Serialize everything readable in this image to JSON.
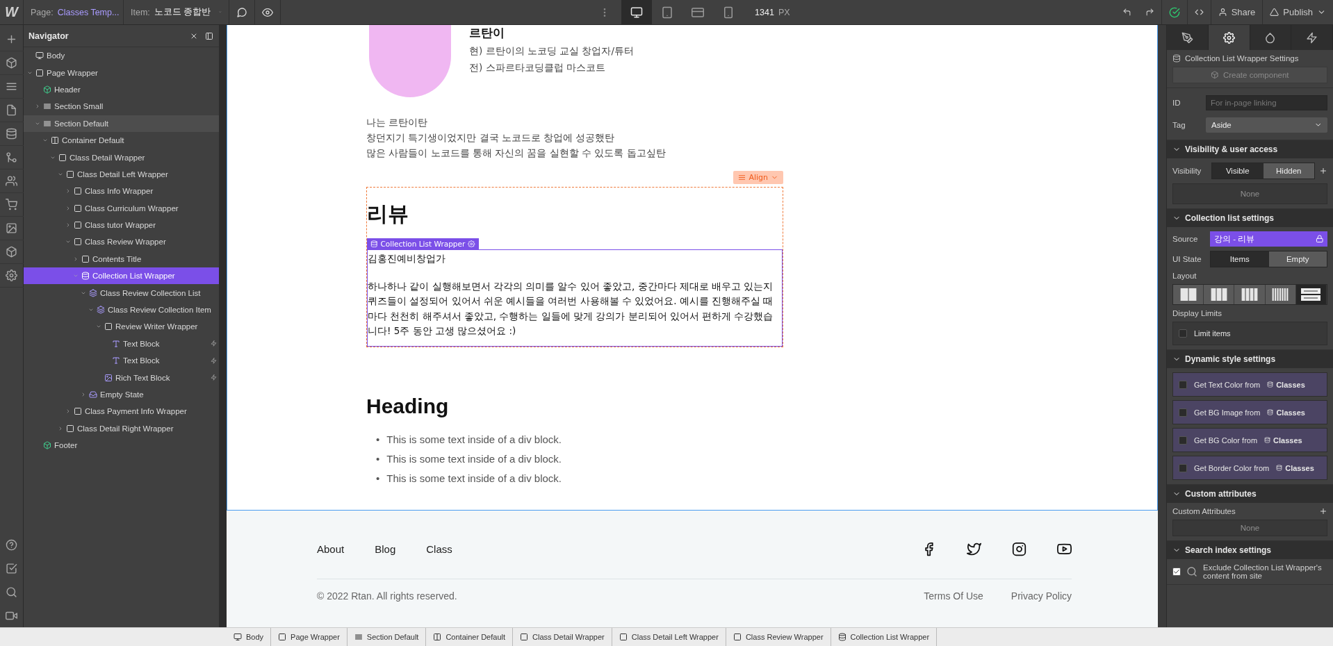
{
  "toolbar": {
    "logo": "W",
    "page_label": "Page:",
    "page_name": "Classes Temp...",
    "item_label": "Item:",
    "item_name": "노코드 종합반",
    "devices": [
      {
        "kind": "desktop",
        "selected": true
      },
      {
        "kind": "tablet",
        "selected": false
      },
      {
        "kind": "landscape",
        "selected": false
      },
      {
        "kind": "portrait",
        "selected": false
      }
    ],
    "width_value": "1341",
    "width_unit": "PX",
    "share": "Share",
    "publish": "Publish"
  },
  "navigator": {
    "title": "Navigator",
    "tree": [
      {
        "label": "Body",
        "kind": "body",
        "selected": false
      },
      {
        "label": "Page Wrapper",
        "kind": "box",
        "expanded": true,
        "selected": false,
        "children": [
          {
            "label": "Header",
            "kind": "symbol",
            "selected": false
          },
          {
            "label": "Section Small",
            "kind": "section",
            "expanded": false,
            "selected": false
          },
          {
            "label": "Section Default",
            "kind": "section",
            "expanded": true,
            "selected": false,
            "highlighted": true,
            "children": [
              {
                "label": "Container Default",
                "kind": "container",
                "expanded": true,
                "selected": false,
                "children": [
                  {
                    "label": "Class Detail Wrapper",
                    "kind": "box",
                    "expanded": true,
                    "selected": false,
                    "children": [
                      {
                        "label": "Class Detail Left Wrapper",
                        "kind": "box",
                        "expanded": true,
                        "selected": false,
                        "children": [
                          {
                            "label": "Class Info Wrapper",
                            "kind": "box",
                            "expanded": false,
                            "selected": false
                          },
                          {
                            "label": "Class Curriculum Wrapper",
                            "kind": "box",
                            "expanded": false,
                            "selected": false
                          },
                          {
                            "label": "Class tutor Wrapper",
                            "kind": "box",
                            "expanded": false,
                            "selected": false
                          },
                          {
                            "label": "Class Review Wrapper",
                            "kind": "box",
                            "expanded": true,
                            "selected": false,
                            "children": [
                              {
                                "label": "Contents Title",
                                "kind": "box",
                                "expanded": false,
                                "selected": false
                              },
                              {
                                "label": "Collection List Wrapper",
                                "kind": "collection",
                                "expanded": true,
                                "selected": true,
                                "children": [
                                  {
                                    "label": "Class Review Collection List",
                                    "kind": "collection-list",
                                    "expanded": true,
                                    "selected": false,
                                    "children": [
                                      {
                                        "label": "Class Review Collection Item",
                                        "kind": "collection-list",
                                        "expanded": true,
                                        "selected": false,
                                        "children": [
                                          {
                                            "label": "Review Writer Wrapper",
                                            "kind": "box",
                                            "expanded": true,
                                            "selected": false,
                                            "children": [
                                              {
                                                "label": "Text Block",
                                                "kind": "text",
                                                "bound": true,
                                                "selected": false
                                              },
                                              {
                                                "label": "Text Block",
                                                "kind": "text",
                                                "bound": true,
                                                "selected": false
                                              }
                                            ]
                                          },
                                          {
                                            "label": "Rich Text Block",
                                            "kind": "richtext",
                                            "bound": true,
                                            "selected": false
                                          }
                                        ]
                                      }
                                    ]
                                  },
                                  {
                                    "label": "Empty State",
                                    "kind": "empty",
                                    "expanded": false,
                                    "selected": false
                                  }
                                ]
                              }
                            ]
                          },
                          {
                            "label": "Class Payment Info Wrapper",
                            "kind": "box",
                            "expanded": false,
                            "selected": false
                          }
                        ]
                      },
                      {
                        "label": "Class Detail Right Wrapper",
                        "kind": "box",
                        "expanded": false,
                        "selected": false
                      }
                    ]
                  }
                ]
              }
            ]
          },
          {
            "label": "Footer",
            "kind": "symbol",
            "selected": false
          }
        ]
      }
    ]
  },
  "canvas": {
    "profile": {
      "name": "르탄이",
      "lines": [
        "현) 르탄이의 노코딩 교실 창업자/튜터",
        "전) 스파르타코딩클럽 마스코트"
      ]
    },
    "intro": [
      "나는 르탄이탄",
      "창던지기 특기생이었지만 결국 노코드로 창업에 성공했탄",
      "많은 사람들이 노코드를 통해 자신의 꿈을 실현할 수 있도록 돕고싶탄"
    ],
    "align_button": "Align",
    "review_heading": "리뷰",
    "selection_label": "Collection List Wrapper",
    "reviewer": "김홍진예비창업가",
    "review_text": "하나하나 같이 실행해보면서 각각의 의미를 알수 있어 좋았고, 중간마다 제대로 배우고 있는지 퀴즈들이 설정되어 있어서 쉬운 예시들을 여러번 사용해볼 수 있었어요. 예시를 진행해주실 때마다 천천히 해주셔서 좋았고, 수행하는 일들에 맞게 강의가 분리되어 있어서 편하게 수강했습니다! 5주 동안 고생 많으셨어요 :)",
    "heading": "Heading",
    "bullet_marker": "•",
    "bullets": [
      "This is some text inside of a div block.",
      "This is some text inside of a div block.",
      "This is some text inside of a div block."
    ]
  },
  "footer": {
    "links": [
      "About",
      "Blog",
      "Class"
    ],
    "social": [
      {
        "kind": "facebook"
      },
      {
        "kind": "twitter"
      },
      {
        "kind": "instagram"
      },
      {
        "kind": "youtube"
      }
    ],
    "copyright": "© 2022 Rtan. All rights reserved.",
    "legal_links": [
      "Terms Of Use",
      "Privacy Policy"
    ]
  },
  "breadcrumb": [
    {
      "label": "Body",
      "kind": "body"
    },
    {
      "label": "Page Wrapper",
      "kind": "box"
    },
    {
      "label": "Section Default",
      "kind": "section"
    },
    {
      "label": "Container Default",
      "kind": "container"
    },
    {
      "label": "Class Detail Wrapper",
      "kind": "box"
    },
    {
      "label": "Class Detail Left Wrapper",
      "kind": "box"
    },
    {
      "label": "Class Review Wrapper",
      "kind": "box"
    },
    {
      "label": "Collection List Wrapper",
      "kind": "collection"
    }
  ],
  "panel": {
    "tabs": [
      {
        "kind": "style",
        "selected": false
      },
      {
        "kind": "settings",
        "selected": true
      },
      {
        "kind": "swatches",
        "selected": false
      },
      {
        "kind": "interactions",
        "selected": false
      }
    ],
    "title": "Collection List Wrapper Settings",
    "create_component": "Create component",
    "id_label": "ID",
    "id_placeholder": "For in-page linking",
    "tag_label": "Tag",
    "tag_value": "Aside",
    "visibility": {
      "header": "Visibility & user access",
      "label": "Visibility",
      "options": [
        {
          "label": "Visible",
          "selected": true
        },
        {
          "label": "Hidden",
          "selected": false
        }
      ],
      "conditions": "None"
    },
    "collection": {
      "header": "Collection list settings",
      "source_label": "Source",
      "source_value": "강의 - 리뷰",
      "ui_state_label": "UI State",
      "ui_states": [
        {
          "label": "Items",
          "selected": true
        },
        {
          "label": "Empty",
          "selected": false
        }
      ],
      "layout_label": "Layout",
      "layouts": [
        {
          "kind": "cols2",
          "selected": false
        },
        {
          "kind": "cols3",
          "selected": false
        },
        {
          "kind": "cols4",
          "selected": false
        },
        {
          "kind": "cols6",
          "selected": false
        },
        {
          "kind": "rows",
          "selected": true
        }
      ],
      "limits_label": "Display Limits",
      "limit_items": {
        "label": "Limit items",
        "checked": false
      }
    },
    "dynamic": {
      "header": "Dynamic style settings",
      "items": [
        {
          "label": "Get Text Color from",
          "source": "Classes",
          "checked": false
        },
        {
          "label": "Get BG Image from",
          "source": "Classes",
          "checked": false
        },
        {
          "label": "Get BG Color from",
          "source": "Classes",
          "checked": false
        },
        {
          "label": "Get Border Color from",
          "source": "Classes",
          "checked": false
        }
      ]
    },
    "attributes": {
      "header": "Custom attributes",
      "label": "Custom Attributes",
      "empty": "None"
    },
    "search": {
      "header": "Search index settings",
      "exclude": {
        "label": "Exclude Collection List Wrapper's content from site",
        "checked": true
      }
    }
  }
}
